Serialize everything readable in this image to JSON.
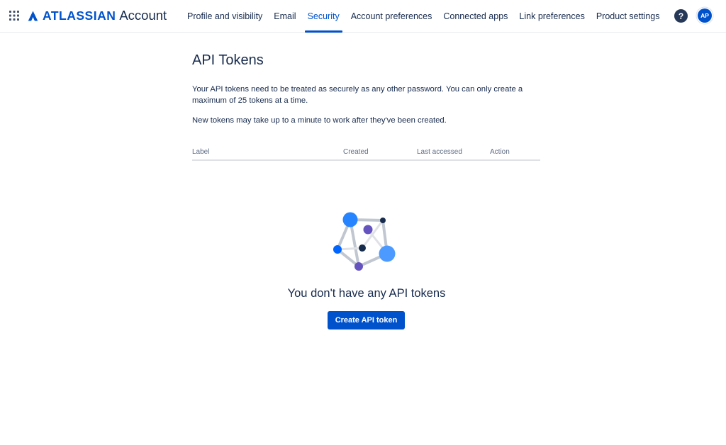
{
  "header": {
    "app_switcher_icon": "grid-icon",
    "brand_name": "ATLASSIAN",
    "product_name": "Account",
    "nav": [
      {
        "label": "Profile and visibility",
        "active": false
      },
      {
        "label": "Email",
        "active": false
      },
      {
        "label": "Security",
        "active": true
      },
      {
        "label": "Account preferences",
        "active": false
      },
      {
        "label": "Connected apps",
        "active": false
      },
      {
        "label": "Link preferences",
        "active": false
      },
      {
        "label": "Product settings",
        "active": false
      }
    ],
    "help_label": "?",
    "avatar_initials": "AP"
  },
  "page": {
    "title": "API Tokens",
    "description_1": "Your API tokens need to be treated as securely as any other password. You can only create a maximum of 25 tokens at a time.",
    "description_2": "New tokens may take up to a minute to work after they've been created."
  },
  "table": {
    "columns": [
      "Label",
      "Created",
      "Last accessed",
      "Action"
    ],
    "rows": []
  },
  "empty_state": {
    "illustration": "token-network-illustration",
    "title": "You don't have any API tokens",
    "button_label": "Create API token"
  },
  "colors": {
    "brand_blue": "#0052cc",
    "text": "#172b4d",
    "muted": "#5e6c84",
    "divider": "#dfe1e6"
  }
}
